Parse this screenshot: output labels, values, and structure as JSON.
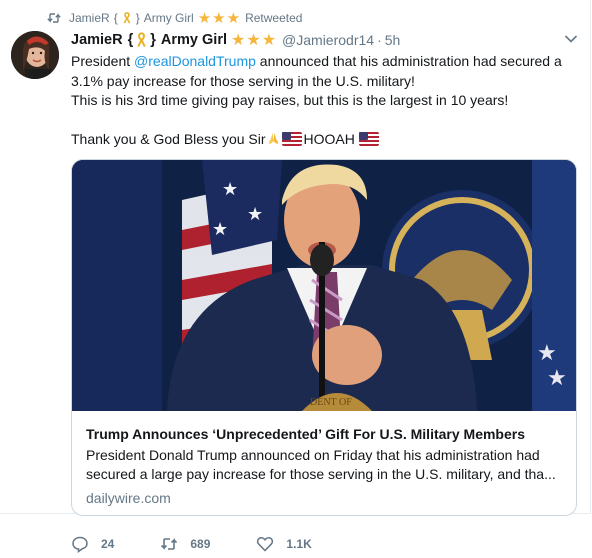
{
  "retweet": {
    "name": "JamieR",
    "brace_open": "{",
    "brace_close": "}",
    "title": "Army Girl",
    "label": "Retweeted"
  },
  "tweet": {
    "name": "JamieR",
    "brace_open": "{",
    "brace_close": "}",
    "title": "Army Girl",
    "stars": "★★★",
    "handle": "@Jamierodr14",
    "dot": "·",
    "time": "5h",
    "text": {
      "l1_pre": "President ",
      "l1_mention": "@realDonaldTrump",
      "l1_post": " announced that his administration had secured a",
      "l2": "3.1% pay increase for those serving in the U.S. military!",
      "l3": "This is his 3rd time giving pay raises, but this is the largest in 10 years!",
      "l4_pre": "Thank you & God Bless you Sir",
      "l4_mid": "HOOAH"
    }
  },
  "card": {
    "title": "Trump Announces ‘Unprecedented’ Gift For U.S. Military Members",
    "desc_l1": "President Donald Trump announced on Friday that his administration had",
    "desc_l2": "secured a large pay increase for those serving in the U.S. military, and tha...",
    "domain": "dailywire.com"
  },
  "actions": {
    "reply_count": "24",
    "retweet_count": "689",
    "like_count": "1.1K"
  },
  "colors": {
    "link": "#1b95e0",
    "muted": "#657786",
    "star": "#f6b53b"
  }
}
